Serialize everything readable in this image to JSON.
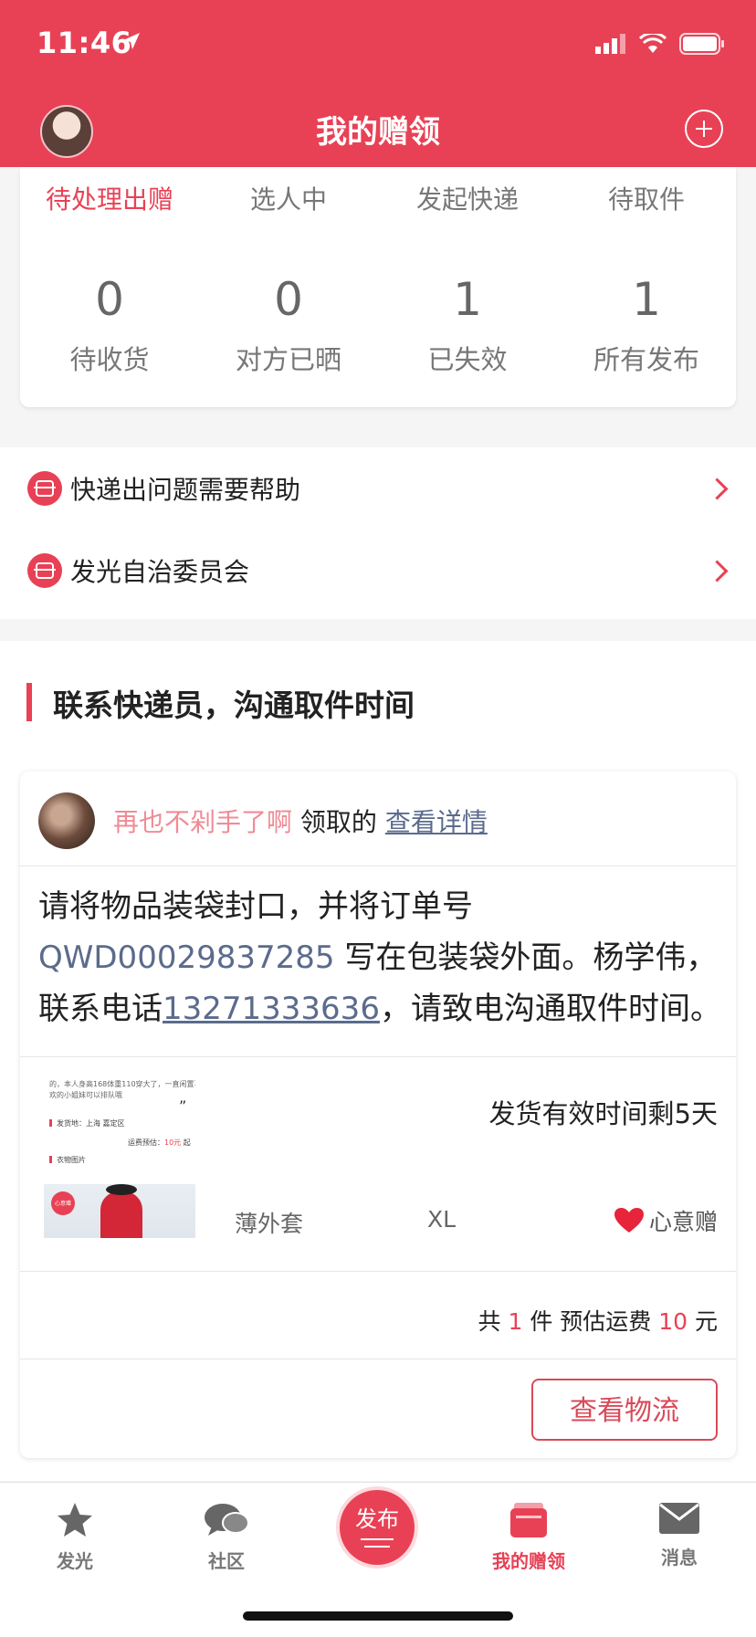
{
  "status": {
    "time": "11:46"
  },
  "nav": {
    "title": "我的赠领"
  },
  "tabs": [
    "待处理出赠",
    "选人中",
    "发起快递",
    "待取件"
  ],
  "counts": [
    {
      "value": "0",
      "label": "待收货"
    },
    {
      "value": "0",
      "label": "对方已晒"
    },
    {
      "value": "1",
      "label": "已失效"
    },
    {
      "value": "1",
      "label": "所有发布"
    }
  ],
  "help": [
    {
      "label": "快递出问题需要帮助"
    },
    {
      "label": "发光自治委员会"
    }
  ],
  "section": {
    "title": "联系快递员，沟通取件时间"
  },
  "order": {
    "user": "再也不剁手了啊",
    "claim_text": "领取的",
    "detail_link": "查看详情",
    "msg_part1": "请将物品装袋封口，并将订单号 ",
    "order_no": "QWD00029837285",
    "msg_part2": " 写在包装袋外面。杨学伟，联系电话",
    "phone": "13271333636",
    "msg_part3": "，请致电沟通取件时间。",
    "valid_text": "发货有效时间剩5天",
    "item_name": "薄外套",
    "item_size": "XL",
    "gift_type": "心意赠",
    "summary_pre": "共 ",
    "count": "1",
    "summary_mid": " 件 预估运费 ",
    "fee": "10",
    "summary_post": " 元",
    "logistics_button": "查看物流",
    "thumb": {
      "text1": "的，本人身高168体重110穿大了，一直闲置喜",
      "text2": "欢的小姐妹可以排队哦",
      "text3": "发货地：上海 嘉定区",
      "text4": "运费预估：",
      "text4_fee": "10元",
      "text4_suffix": "起",
      "text5": "衣物图片",
      "badge": "心意赠"
    }
  },
  "tabbar": {
    "items": [
      {
        "label": "发光",
        "icon": "star-icon"
      },
      {
        "label": "社区",
        "icon": "chat-bubbles-icon"
      },
      {
        "label": "发布",
        "icon": "publish-icon"
      },
      {
        "label": "我的赠领",
        "icon": "wallet-icon"
      },
      {
        "label": "消息",
        "icon": "envelope-icon"
      }
    ]
  },
  "colors": {
    "accent": "#e84155",
    "link": "#5b6b8c"
  }
}
